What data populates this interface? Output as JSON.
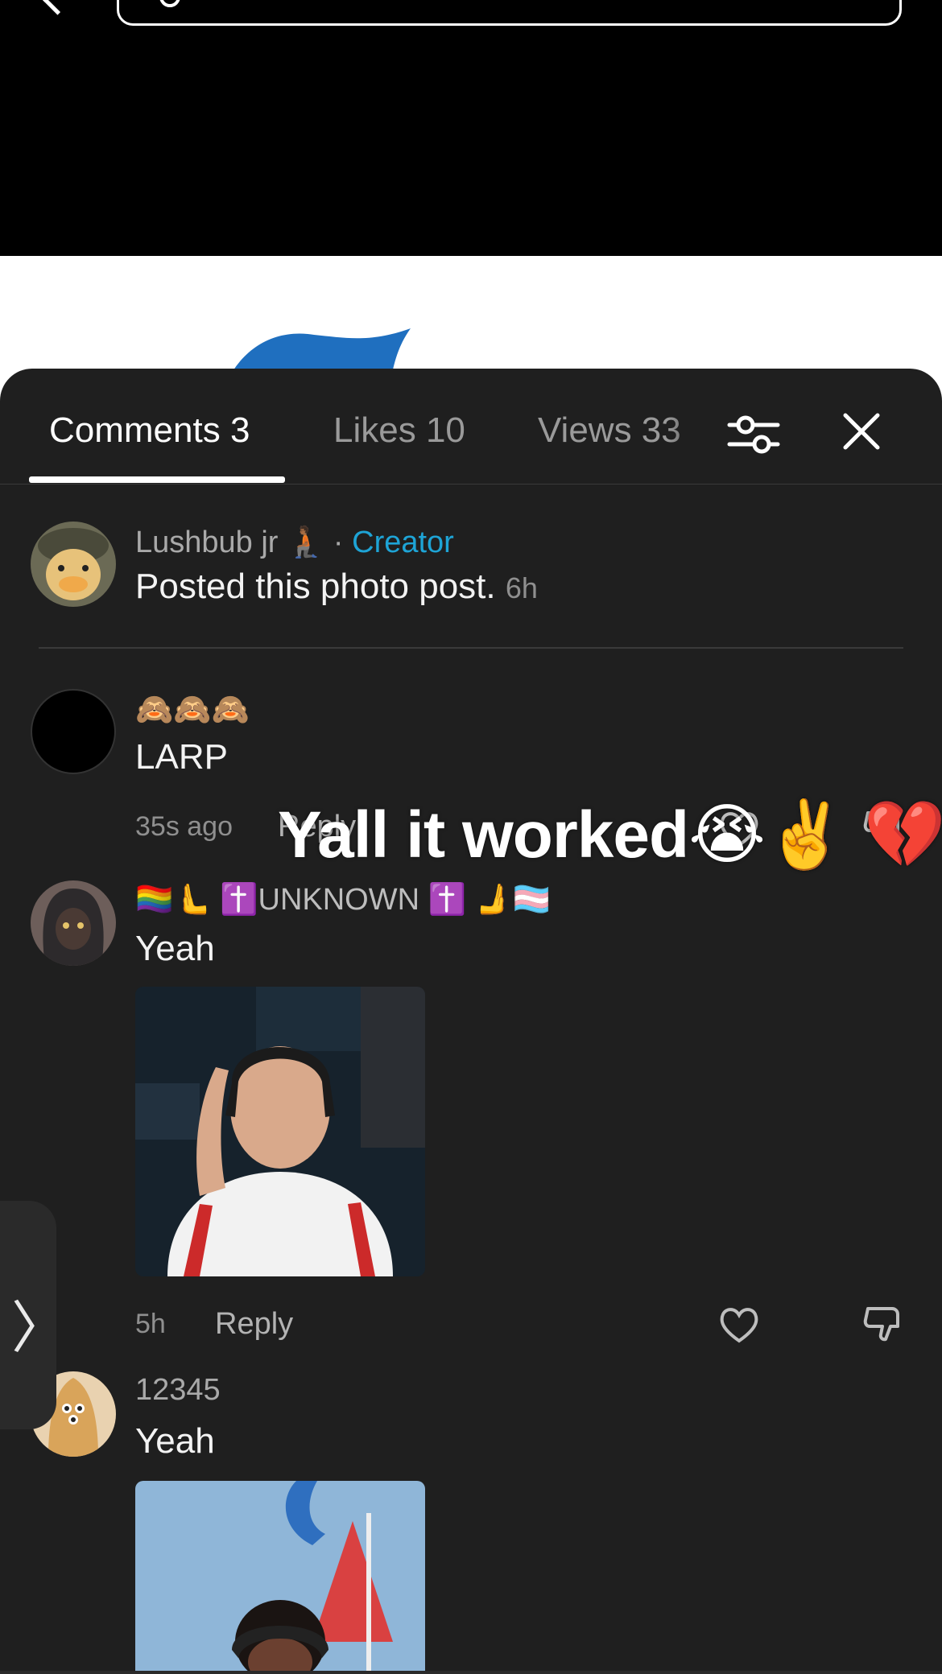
{
  "header": {
    "back_icon": "chevron-left-icon",
    "search_icon": "search-icon"
  },
  "tabs": [
    {
      "label": "Comments 3",
      "active": true
    },
    {
      "label": "Likes 10",
      "active": false
    },
    {
      "label": "Views 33",
      "active": false
    }
  ],
  "toolbar": {
    "filter_icon": "sliders-icon",
    "close_icon": "close-icon"
  },
  "creator_post": {
    "username": "Lushbub jr 🧎🏾",
    "separator": "·",
    "creator_label": "Creator",
    "text": "Posted this photo post.",
    "time": "6h"
  },
  "comments": [
    {
      "username": "🙈🙈🙈",
      "text": "LARP",
      "time": "35s ago",
      "reply_label": "Reply"
    },
    {
      "username": "🏳️‍🌈🫷 ✝️UNKNOWN ✝️ 🫸🏳️‍⚧️",
      "text": "Yeah",
      "time": "5h",
      "reply_label": "Reply",
      "has_image": true
    },
    {
      "username": "12345",
      "text": "Yeah",
      "has_image": true
    }
  ],
  "overlay": {
    "caption": "Yall it worked😭✌️ 💔"
  },
  "side_handle": {
    "glyph": "〉"
  },
  "colors": {
    "sheet_bg": "#1f1f1f",
    "creator_accent": "#1ea4d6",
    "top_bg": "#000000"
  }
}
